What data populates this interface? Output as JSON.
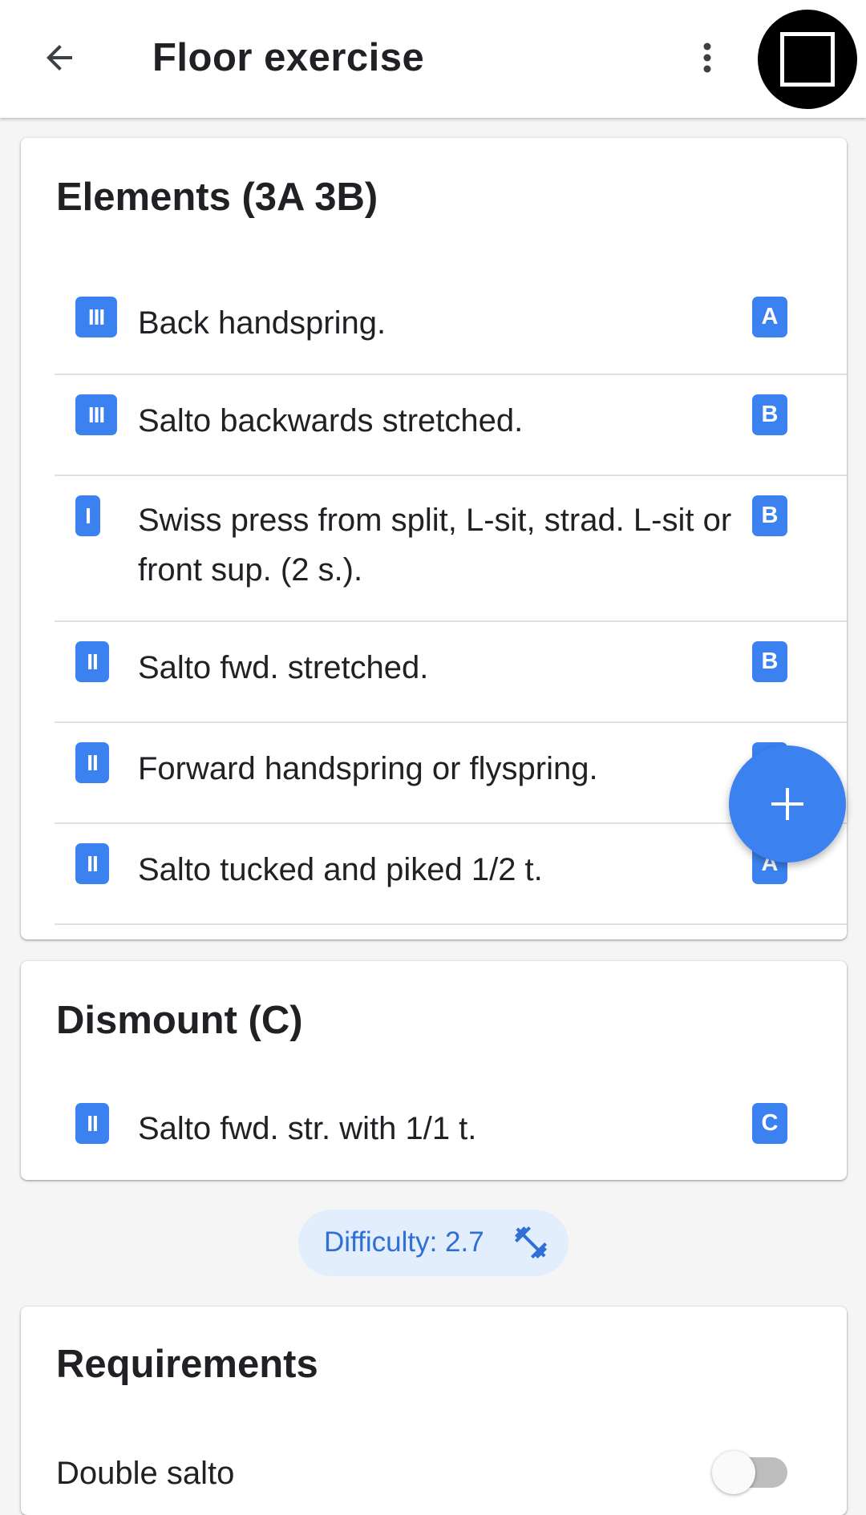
{
  "appbar": {
    "title": "Floor exercise"
  },
  "elements_card": {
    "title": "Elements (3A 3B)",
    "rows": [
      {
        "group": "III",
        "text": "Back handspring.",
        "level": "A"
      },
      {
        "group": "III",
        "text": "Salto backwards stretched.",
        "level": "B"
      },
      {
        "group": "I",
        "text": "Swiss press from split, L-sit, strad. L-sit or front sup. (2 s.).",
        "level": "B"
      },
      {
        "group": "II",
        "text": "Salto fwd. stretched.",
        "level": "B"
      },
      {
        "group": "II",
        "text": "Forward handspring or flyspring.",
        "level": "A"
      },
      {
        "group": "II",
        "text": "Salto tucked and piked 1/2 t.",
        "level": "A"
      }
    ]
  },
  "dismount_card": {
    "title": "Dismount (C)",
    "rows": [
      {
        "group": "II",
        "text": "Salto fwd. str. with 1/1 t.",
        "level": "C"
      }
    ]
  },
  "difficulty_chip": {
    "label": "Difficulty: 2.7",
    "icon": "fitness-dumbbell-icon"
  },
  "requirements_card": {
    "title": "Requirements",
    "items": [
      {
        "label": "Double salto",
        "enabled": false
      }
    ]
  },
  "fab": {
    "icon": "plus-icon"
  },
  "colors": {
    "accent": "#3b82f0",
    "chip_bg": "#e3eefc",
    "chip_text": "#2f6fd6"
  }
}
